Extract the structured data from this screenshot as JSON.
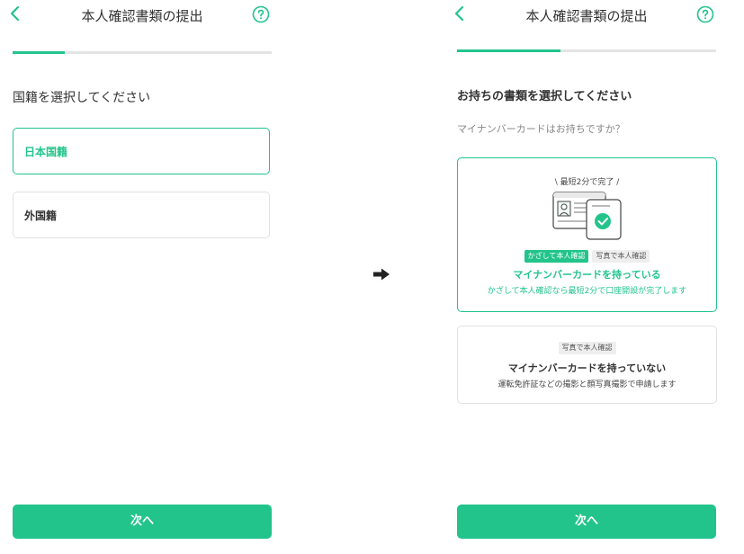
{
  "left": {
    "header": {
      "title": "本人確認書類の提出"
    },
    "progress": {
      "fraction": 0.2
    },
    "question": "国籍を選択してください",
    "options": [
      {
        "label": "日本国籍",
        "selected": true
      },
      {
        "label": "外国籍",
        "selected": false
      }
    ],
    "next_label": "次へ"
  },
  "right": {
    "header": {
      "title": "本人確認書類の提出"
    },
    "progress": {
      "fraction": 0.4
    },
    "question": "お持ちの書類を選択してください",
    "subtext": "マイナンバーカードはお持ちですか？",
    "card_with": {
      "tagline": "\\ 最短2分で完了 /",
      "badge_green": "かざして本人確認",
      "badge_gray": "写真で本人確認",
      "title": "マイナンバーカードを持っている",
      "desc": "かざして本人確認なら最短2分で口座開設が完了します"
    },
    "card_without": {
      "badge": "写真で本人確認",
      "title": "マイナンバーカードを持っていない",
      "desc": "運転免許証などの撮影と顔写真撮影で申請します"
    },
    "next_label": "次へ"
  },
  "colors": {
    "accent": "#22c48c",
    "border": "#e2e2e2",
    "track": "#e4e4e4"
  },
  "icons": {
    "back": "chevron-left-icon",
    "help": "question-circle-icon",
    "transition": "arrow-right-icon"
  }
}
